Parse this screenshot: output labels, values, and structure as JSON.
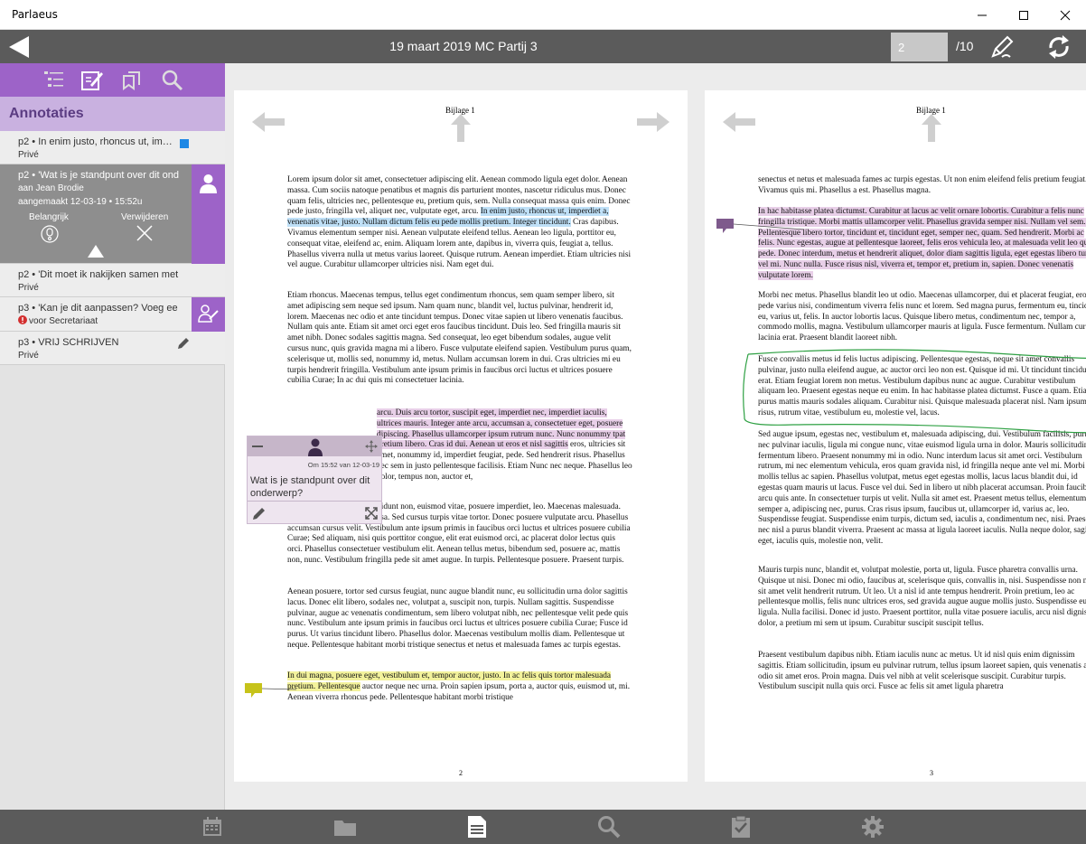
{
  "window": {
    "title": "Parlaeus"
  },
  "toolbar": {
    "doc_title": "19 maart 2019 MC Partij 3",
    "page_value": "2",
    "page_total": "/10"
  },
  "sidebar": {
    "heading": "Annotaties",
    "tools": [
      "list-icon",
      "edit-icon",
      "annotations-icon",
      "search-icon"
    ],
    "items": [
      {
        "title": "p2 • In enim justo, rhoncus ut, im…",
        "sub": "Privé",
        "marker_color": "#1e88e5"
      },
      {
        "title": "p2 • 'Wat is je standpunt over dit ond…",
        "sub": "aan Jean Brodie",
        "sub2": "aangemaakt 12-03-19 • 15:52u",
        "action1": "Belangrijk",
        "action2": "Verwijderen"
      },
      {
        "title": "p2 • 'Dit moet ik nakijken samen met…",
        "sub": "Privé"
      },
      {
        "title": "p3 • 'Kan je dit aanpassen? Voeg ee…",
        "sub": "voor Secretariaat"
      },
      {
        "title": "p3 • VRIJ SCHRIJVEN",
        "sub": "Privé"
      }
    ]
  },
  "pages": {
    "left": {
      "header": "Bijlage 1",
      "number": "2",
      "para1": {
        "before": "Lorem ipsum dolor sit amet, consectetuer adipiscing elit. Aenean commodo ligula eget dolor. Aenean massa. Cum sociis natoque penatibus et magnis dis parturient montes, nascetur ridiculus mus. Donec quam felis, ultricies nec, pellentesque eu, pretium quis, sem. Nulla consequat massa quis enim. Donec pede justo, fringilla vel, aliquet nec, vulputate eget, arcu. ",
        "highlight": "In enim justo, rhoncus ut, imperdiet a, venenatis vitae, justo. Nullam dictum felis eu pede mollis pretium. Integer tincidunt.",
        "after": " Cras dapibus. Vivamus elementum semper nisi. Aenean vulputate eleifend tellus. Aenean leo ligula, porttitor eu, consequat vitae, eleifend ac, enim. Aliquam lorem ante, dapibus in, viverra quis, feugiat a, tellus. Phasellus viverra nulla ut metus varius laoreet. Quisque rutrum. Aenean imperdiet. Etiam ultricies nisi vel augue. Curabitur ullamcorper ultricies nisi. Nam eget dui."
      },
      "para2": "Etiam rhoncus. Maecenas tempus, tellus eget condimentum rhoncus, sem quam semper libero, sit amet adipiscing sem neque sed ipsum. Nam quam nunc, blandit vel, luctus pulvinar, hendrerit id, lorem. Maecenas nec odio et ante tincidunt tempus. Donec vitae sapien ut libero venenatis faucibus. Nullam quis ante. Etiam sit amet orci eget eros faucibus tincidunt. Duis leo. Sed fringilla mauris sit amet nibh. Donec sodales sagittis magna. Sed consequat, leo eget bibendum sodales, augue velit cursus nunc, quis gravida magna mi a libero. Fusce vulputate eleifend sapien. Vestibulum purus quam, scelerisque ut, mollis sed, nonummy id, metus. Nullam accumsan lorem in dui. Cras ultricies mi eu turpis hendrerit fringilla. Vestibulum ante ipsum primis in faucibus orci luctus et ultrices posuere cubilia Curae; In ac dui quis mi consectetuer lacinia.",
      "para3": {
        "highlight": "arcu. Duis arcu tortor, suscipit eget, imperdiet nec, imperdiet iaculis, ultrices mauris. Integer ante arcu, accumsan a, consectetuer eget, posuere dipiscing. Phasellus ullamcorper ipsum rutrum nunc. Nunc nonummy tpat pretium libero. Cras id dui. Aenean ut eros et nisl sagittis",
        "after": " eros, ultricies sit amet, nonummy id, imperdiet feugiat, pede. Sed hendrerit risus. Phasellus nec sem in justo pellentesque facilisis. Etiam Nunc nec neque. Phasellus leo dolor, tempus non, auctor et,"
      },
      "para4": "Curabitur ligula sapien, tincidunt non, euismod vitae, posuere imperdiet, leo. Maecenas malesuada. Praesent congue erat at massa. Sed cursus turpis vitae tortor. Donec posuere vulputate arcu. Phasellus accumsan cursus velit. Vestibulum ante ipsum primis in faucibus orci luctus et ultrices posuere cubilia Curae; Sed aliquam, nisi quis porttitor congue, elit erat euismod orci, ac placerat dolor lectus quis orci. Phasellus consectetuer vestibulum elit. Aenean tellus metus, bibendum sed, posuere ac, mattis non, nunc. Vestibulum fringilla pede sit amet augue. In turpis. Pellentesque posuere. Praesent turpis.",
      "para5": "Aenean posuere, tortor sed cursus feugiat, nunc augue blandit nunc, eu sollicitudin urna dolor sagittis lacus. Donec elit libero, sodales nec, volutpat a, suscipit non, turpis. Nullam sagittis. Suspendisse pulvinar, augue ac venenatis condimentum, sem libero volutpat nibh, nec pellentesque velit pede quis nunc. Vestibulum ante ipsum primis in faucibus orci luctus et ultrices posuere cubilia Curae; Fusce id purus. Ut varius tincidunt libero. Phasellus dolor. Maecenas vestibulum mollis diam. Pellentesque ut neque. Pellentesque habitant morbi tristique senectus et netus et malesuada fames ac turpis egestas.",
      "para6": {
        "highlight": "In dui magna, posuere eget, vestibulum et, tempor auctor, justo. In ac felis quis tortor malesuada pretium. Pellentesque",
        "after": " auctor neque nec urna. Proin sapien ipsum, porta a, auctor quis, euismod ut, mi. Aenean viverra rhoncus pede. Pellentesque habitant morbi tristique"
      }
    },
    "right": {
      "header": "Bijlage 1",
      "number": "3",
      "para1": "senectus et netus et malesuada fames ac turpis egestas. Ut non enim eleifend felis pretium feugiat. Vivamus quis mi. Phasellus a est. Phasellus magna.",
      "para2_highlight": "In hac habitasse platea dictumst. Curabitur at lacus ac velit ornare lobortis. Curabitur a felis nunc fringilla tristique. Morbi mattis ullamcorper velit. Phasellus gravida semper nisi. Nullam vel sem. Pellentesque libero tortor, tincidunt et, tincidunt eget, semper nec, quam. Sed hendrerit. Morbi ac felis. Nunc egestas, augue at pellentesque laoreet, felis eros vehicula leo, at malesuada velit leo quis pede. Donec interdum, metus et hendrerit aliquet, dolor diam sagittis ligula, eget egestas libero turpis vel mi. Nunc nulla. Fusce risus nisl, viverra et, tempor et, pretium in, sapien. Donec venenatis vulputate lorem.",
      "para3": "Morbi nec metus. Phasellus blandit leo ut odio. Maecenas ullamcorper, dui et placerat feugiat, eros pede varius nisi, condimentum viverra felis nunc et lorem. Sed magna purus, fermentum eu, tincidunt eu, varius ut, felis. In auctor lobortis lacus. Quisque libero metus, condimentum nec, tempor a, commodo mollis, magna. Vestibulum ullamcorper mauris at ligula. Fusce fermentum. Nullam cursus lacinia erat. Praesent blandit laoreet nibh.",
      "para4": "Fusce convallis metus id felis luctus adipiscing. Pellentesque egestas, neque sit amet convallis pulvinar, justo nulla eleifend augue, ac auctor orci leo non est. Quisque id mi. Ut tincidunt tincidunt erat. Etiam feugiat lorem non metus. Vestibulum dapibus nunc ac augue. Curabitur vestibulum aliquam leo. Praesent egestas neque eu enim. In hac habitasse platea dictumst. Fusce a quam. Etiam ut purus mattis mauris sodales aliquam. Curabitur nisi. Quisque malesuada placerat nisl. Nam ipsum risus, rutrum vitae, vestibulum eu, molestie vel, lacus.",
      "para5": "Sed augue ipsum, egestas nec, vestibulum et, malesuada adipiscing, dui. Vestibulum facilisis, purus nec pulvinar iaculis, ligula mi congue nunc, vitae euismod ligula urna in dolor. Mauris sollicitudin fermentum libero. Praesent nonummy mi in odio. Nunc interdum lacus sit amet orci. Vestibulum rutrum, mi nec elementum vehicula, eros quam gravida nisl, id fringilla neque ante vel mi. Morbi mollis tellus ac sapien. Phasellus volutpat, metus eget egestas mollis, lacus lacus blandit dui, id egestas quam mauris ut lacus. Fusce vel dui. Sed in libero ut nibh placerat accumsan. Proin faucibus arcu quis ante. In consectetuer turpis ut velit. Nulla sit amet est. Praesent metus tellus, elementum eu, semper a, adipiscing nec, purus. Cras risus ipsum, faucibus ut, ullamcorper id, varius ac, leo. Suspendisse feugiat. Suspendisse enim turpis, dictum sed, iaculis a, condimentum nec, nisi. Praesent nec nisl a purus blandit viverra. Praesent ac massa at ligula laoreet iaculis. Nulla neque dolor, sagittis eget, iaculis quis, molestie non, velit.",
      "para6": "Mauris turpis nunc, blandit et, volutpat molestie, porta ut, ligula. Fusce pharetra convallis urna. Quisque ut nisi. Donec mi odio, faucibus at, scelerisque quis, convallis in, nisi. Suspendisse non nisl sit amet velit hendrerit rutrum. Ut leo. Ut a nisl id ante tempus hendrerit. Proin pretium, leo ac pellentesque mollis, felis nunc ultrices eros, sed gravida augue augue mollis justo. Suspendisse eu ligula. Nulla facilisi. Donec id justo. Praesent porttitor, nulla vitae posuere iaculis, arcu nisl dignissim dolor, a pretium mi sem ut ipsum. Curabitur suscipit suscipit tellus.",
      "para7": "Praesent vestibulum dapibus nibh. Etiam iaculis nunc ac metus. Ut id nisl quis enim dignissim sagittis. Etiam sollicitudin, ipsum eu pulvinar rutrum, tellus ipsum laoreet sapien, quis venenatis ante odio sit amet eros. Proin magna. Duis vel nibh at velit scelerisque suscipit. Curabitur turpis. Vestibulum suscipit nulla quis orci. Fusce ac felis sit amet ligula pharetra"
    }
  },
  "popup": {
    "meta": "Om 15:52 van 12-03-19",
    "text": "Wat is je standpunt over dit onderwerp?"
  },
  "colors": {
    "accent_purple": "#9d63c8",
    "light_purple": "#c9b1e0",
    "toolbar_gray": "#5b5b5b",
    "highlight_blue": "#bfe0f7",
    "highlight_purple": "#e8cfe8",
    "highlight_yellow": "#f3f29c",
    "marker_yellow": "#c6c31a",
    "marker_purple": "#7e5a8c",
    "ink_green": "#2ea043"
  },
  "bottombar": {
    "icons": [
      "calendar-icon",
      "folder-icon",
      "document-icon",
      "search-icon",
      "clipboard-check-icon",
      "settings-icon"
    ],
    "active": "document-icon"
  }
}
